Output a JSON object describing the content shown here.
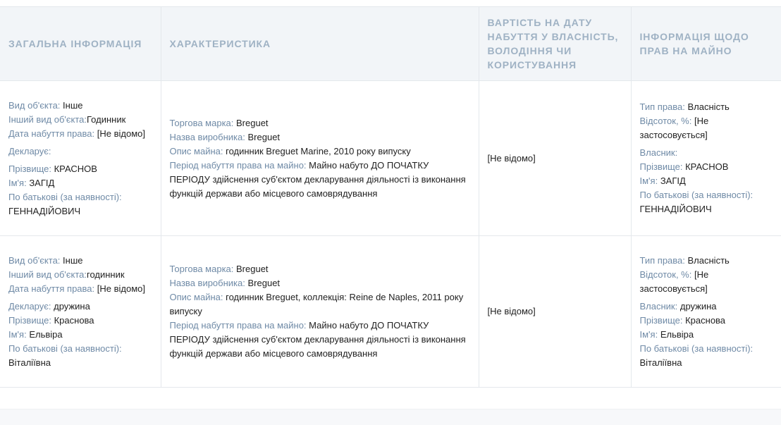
{
  "headers": {
    "general": "ЗАГАЛЬНА ІНФОРМАЦІЯ",
    "characteristic": "ХАРАКТЕРИСТИКА",
    "value": "ВАРТІСТЬ НА ДАТУ НАБУТТЯ У ВЛАСНІСТЬ, ВОЛОДІННЯ ЧИ КОРИСТУВАННЯ",
    "rights": "ІНФОРМАЦІЯ ЩОДО ПРАВ НА МАЙНО"
  },
  "labels": {
    "object_type": "Вид об'єкта:",
    "other_object_type": "Інший вид об'єкта:",
    "acquisition_date": "Дата набуття права:",
    "declarant": "Декларує:",
    "surname": "Прізвище:",
    "name": "Ім'я:",
    "patronymic": "По батькові (за наявності):",
    "brand": "Торгова марка:",
    "manufacturer": "Назва виробника:",
    "description": "Опис майна:",
    "acquisition_period": "Період набуття права на майно:",
    "right_type": "Тип права:",
    "percent": "Відсоток, %:",
    "owner": "Власник:"
  },
  "rows": [
    {
      "object_type": "Інше",
      "other_object_type": "Годинник",
      "acquisition_date": "[Не відомо]",
      "declarant": "",
      "surname": "КРАСНОВ",
      "name": "ЗАГІД",
      "patronymic": "ГЕННАДІЙОВИЧ",
      "brand": "Breguet",
      "manufacturer": "Breguet",
      "description": "годинник Breguet Marine, 2010 року випуску",
      "acquisition_period": "Майно набуто ДО ПОЧАТКУ ПЕРІОДУ здійснення суб'єктом декларування діяльності із виконання функцій держави або місцевого самоврядування",
      "value": "[Не відомо]",
      "right_type": "Власність",
      "percent": "[Не застосовується]",
      "owner": "",
      "owner_surname": "КРАСНОВ",
      "owner_name": "ЗАГІД",
      "owner_patronymic": "ГЕННАДІЙОВИЧ"
    },
    {
      "object_type": "Інше",
      "other_object_type": "годинник",
      "acquisition_date": "[Не відомо]",
      "declarant": "дружина",
      "surname": "Краснова",
      "name": "Ельвіра",
      "patronymic": "Віталіївна",
      "brand": "Breguet",
      "manufacturer": "Breguet",
      "description": "годинник Breguet, коллекція: Reine de Naples, 2011 року випуску",
      "acquisition_period": "Майно набуто ДО ПОЧАТКУ ПЕРІОДУ здійснення суб'єктом декларування діяльності із виконання функцій держави або місцевого самоврядування",
      "value": "[Не відомо]",
      "right_type": "Власність",
      "percent": "[Не застосовується]",
      "owner": "дружина",
      "owner_surname": "Краснова",
      "owner_name": "Ельвіра",
      "owner_patronymic": "Віталіївна"
    }
  ]
}
